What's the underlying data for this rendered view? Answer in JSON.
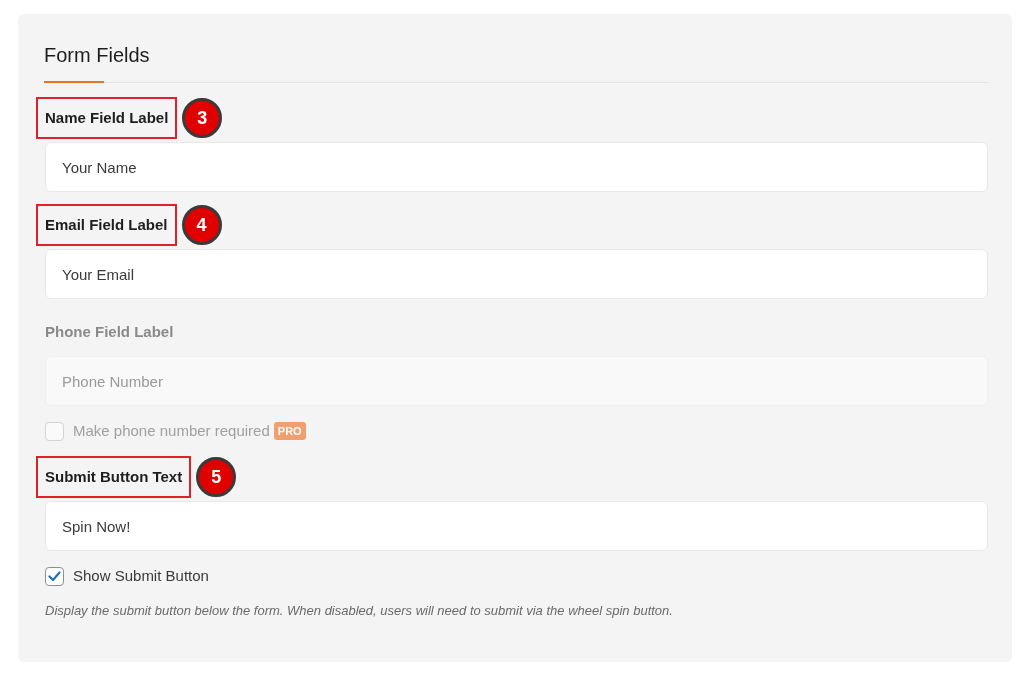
{
  "section": {
    "title": "Form Fields"
  },
  "items": [
    {
      "kind": "field",
      "label": "Name Field Label",
      "highlighted": true,
      "callout": "3",
      "value": "Your Name",
      "disabled": false
    },
    {
      "kind": "field",
      "label": "Email Field Label",
      "highlighted": true,
      "callout": "4",
      "value": "Your Email",
      "disabled": false
    },
    {
      "kind": "field",
      "label": "Phone Field Label",
      "highlighted": false,
      "value": "Phone Number",
      "disabled": true
    },
    {
      "kind": "checkbox",
      "label": "Make phone number required",
      "checked": false,
      "disabled": true,
      "badge": "PRO"
    },
    {
      "kind": "field",
      "label": "Submit Button Text",
      "highlighted": true,
      "callout": "5",
      "value": "Spin Now!",
      "disabled": false
    },
    {
      "kind": "checkbox",
      "label": "Show Submit Button",
      "checked": true,
      "disabled": false
    },
    {
      "kind": "help",
      "text": "Display the submit button below the form. When disabled, users will need to submit via the wheel spin button."
    }
  ]
}
